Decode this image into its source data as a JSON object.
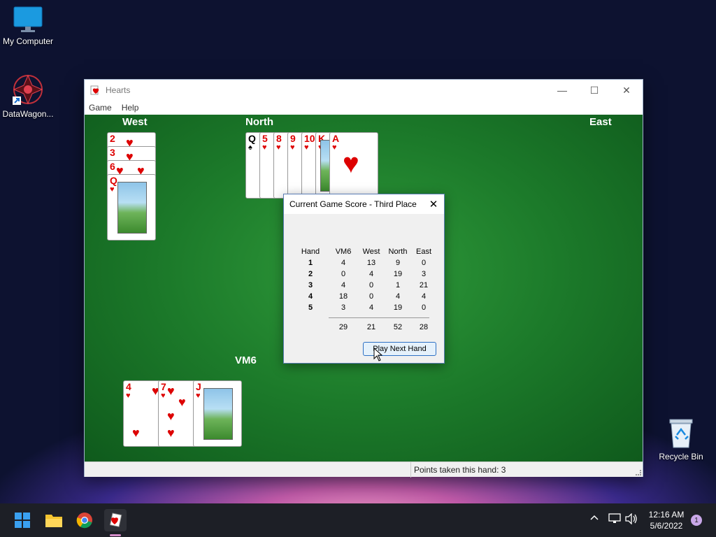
{
  "desktop": {
    "icons": [
      {
        "label": "My Computer"
      },
      {
        "label": "DataWagon..."
      },
      {
        "label": "Recycle Bin"
      }
    ]
  },
  "window": {
    "title": "Hearts",
    "menu": [
      "Game",
      "Help"
    ],
    "status": "Points taken this hand: 3"
  },
  "table": {
    "players": {
      "west": "West",
      "north": "North",
      "east": "East",
      "south": "VM6"
    },
    "west_cards": [
      "2",
      "3",
      "6",
      "Q"
    ],
    "north_cards": [
      "Q",
      "5",
      "8",
      "9",
      "10",
      "K",
      "A"
    ],
    "south_cards": [
      "4",
      "7",
      "J"
    ]
  },
  "dialog": {
    "title": "Current Game Score - Third Place",
    "headers": [
      "Hand",
      "VM6",
      "West",
      "North",
      "East"
    ],
    "rows": [
      [
        "1",
        "4",
        "13",
        "9",
        "0"
      ],
      [
        "2",
        "0",
        "4",
        "19",
        "3"
      ],
      [
        "3",
        "4",
        "0",
        "1",
        "21"
      ],
      [
        "4",
        "18",
        "0",
        "4",
        "4"
      ],
      [
        "5",
        "3",
        "4",
        "19",
        "0"
      ]
    ],
    "totals": [
      "29",
      "21",
      "52",
      "28"
    ],
    "button": "Play Next Hand"
  },
  "taskbar": {
    "time": "12:16 AM",
    "date": "5/6/2022",
    "notifications": "1"
  }
}
